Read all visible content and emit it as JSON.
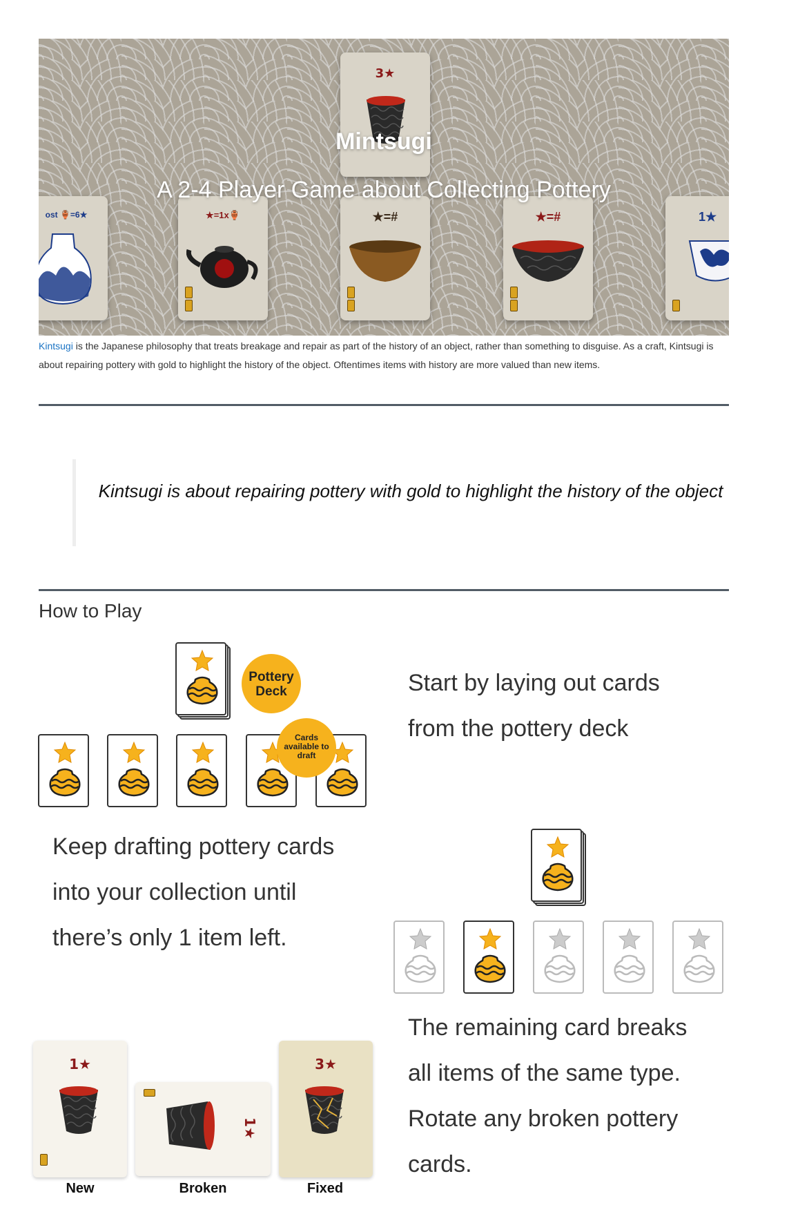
{
  "hero": {
    "title": "Mintsugi",
    "subtitle": "A 2-4 Player Game about Collecting Pottery",
    "top_card_cost": "3★",
    "cards": [
      {
        "label": "ost 🏺=6★"
      },
      {
        "label": "★=1x🏺"
      },
      {
        "label": "★=#"
      },
      {
        "label": "★=#"
      },
      {
        "label": "1★"
      }
    ]
  },
  "intro": {
    "link_text": "Kintsugi",
    "text": " is the Japanese philosophy that treats breakage and repair as part of the history of an object, rather than something to disguise. As a craft, Kintsugi is about repairing pottery with gold to highlight the history of the object. Oftentimes items with history are more valued than new items."
  },
  "quote": "Kintsugi is about repairing pottery with gold to highlight the history of the object",
  "how_to_play": {
    "title": "How to Play",
    "deck_badge": [
      "Pottery",
      "Deck"
    ],
    "draft_badge": [
      "Cards",
      "available to",
      "draft"
    ],
    "step1": [
      "Start by laying out cards",
      "from the pottery deck"
    ],
    "step2": [
      "Keep drafting pottery cards",
      "into your collection until",
      "there’s only 1 item left."
    ],
    "step3": [
      "The remaining card breaks",
      "all items of the same type.",
      "Rotate any broken pottery",
      "cards."
    ],
    "states": {
      "new": {
        "label": "New",
        "cost": "1★"
      },
      "broken": {
        "label": "Broken",
        "cost": "1★"
      },
      "fixed": {
        "label": "Fixed",
        "cost": "3★"
      }
    }
  },
  "colors": {
    "accent_orange": "#f6b21d",
    "link": "#1a73c4",
    "rule": "#525c66",
    "cost_red": "#8b1a1a"
  }
}
